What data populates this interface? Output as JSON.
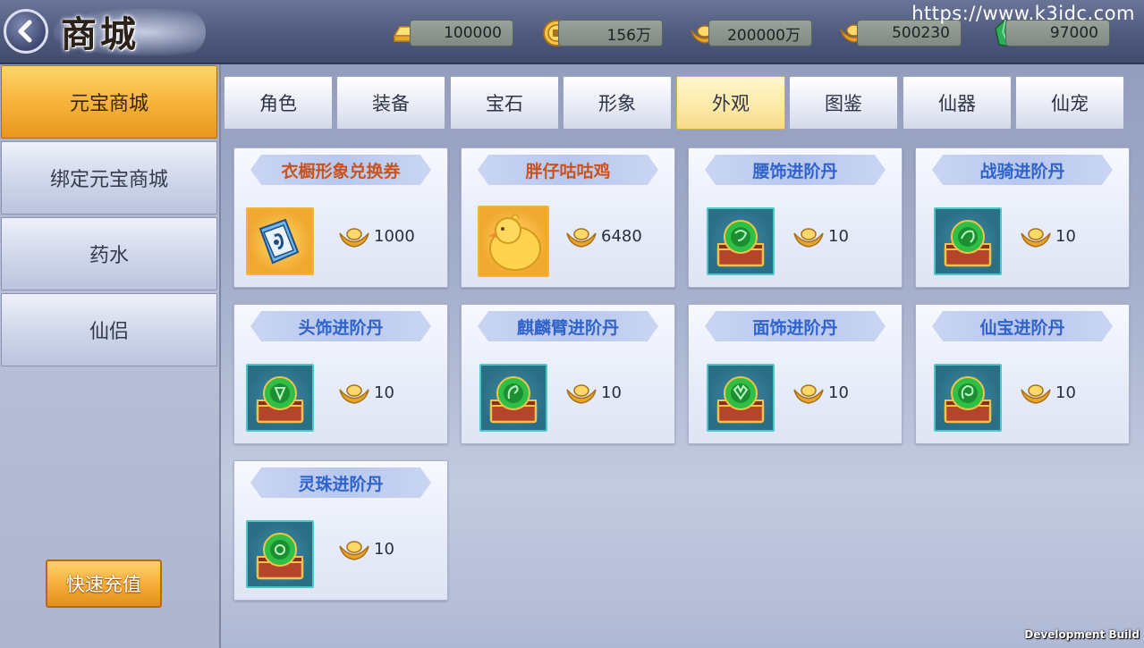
{
  "header": {
    "title": "商城",
    "watermark": "https://www.k3idc.com",
    "currencies": [
      {
        "icon": "gold-bar-icon",
        "value": "100000"
      },
      {
        "icon": "gold-coin-icon",
        "value": "156万"
      },
      {
        "icon": "yuanbao-icon",
        "value": "200000万"
      },
      {
        "icon": "bound-yuanbao-icon",
        "value": "500230"
      },
      {
        "icon": "jade-icon",
        "value": "97000"
      }
    ]
  },
  "sidebar": {
    "items": [
      {
        "label": "元宝商城",
        "active": true
      },
      {
        "label": "绑定元宝商城",
        "active": false
      },
      {
        "label": "药水",
        "active": false
      },
      {
        "label": "仙侣",
        "active": false
      }
    ],
    "recharge_label": "快速充值"
  },
  "tabs": [
    {
      "label": "角色",
      "active": false
    },
    {
      "label": "装备",
      "active": false
    },
    {
      "label": "宝石",
      "active": false
    },
    {
      "label": "形象",
      "active": false
    },
    {
      "label": "外观",
      "active": true
    },
    {
      "label": "图鉴",
      "active": false
    },
    {
      "label": "仙器",
      "active": false
    },
    {
      "label": "仙宠",
      "active": false
    }
  ],
  "items": [
    {
      "name": "衣橱形象兑换券",
      "price": "1000",
      "name_color": "#c8531f",
      "icon": "wardrobe-voucher-icon"
    },
    {
      "name": "胖仔咕咕鸡",
      "price": "6480",
      "name_color": "#c8531f",
      "icon": "chubby-chick-icon"
    },
    {
      "name": "腰饰进阶丹",
      "price": "10",
      "name_color": "#2f63c9",
      "icon": "advance-chest-icon"
    },
    {
      "name": "战骑进阶丹",
      "price": "10",
      "name_color": "#2f63c9",
      "icon": "advance-chest-icon"
    },
    {
      "name": "头饰进阶丹",
      "price": "10",
      "name_color": "#2f63c9",
      "icon": "advance-chest-icon"
    },
    {
      "name": "麒麟臂进阶丹",
      "price": "10",
      "name_color": "#2f63c9",
      "icon": "advance-chest-icon"
    },
    {
      "name": "面饰进阶丹",
      "price": "10",
      "name_color": "#2f63c9",
      "icon": "advance-chest-icon"
    },
    {
      "name": "仙宝进阶丹",
      "price": "10",
      "name_color": "#2f63c9",
      "icon": "advance-chest-icon"
    },
    {
      "name": "灵珠进阶丹",
      "price": "10",
      "name_color": "#2f63c9",
      "icon": "advance-chest-icon"
    }
  ],
  "footer": {
    "dev_build": "Development Build"
  }
}
